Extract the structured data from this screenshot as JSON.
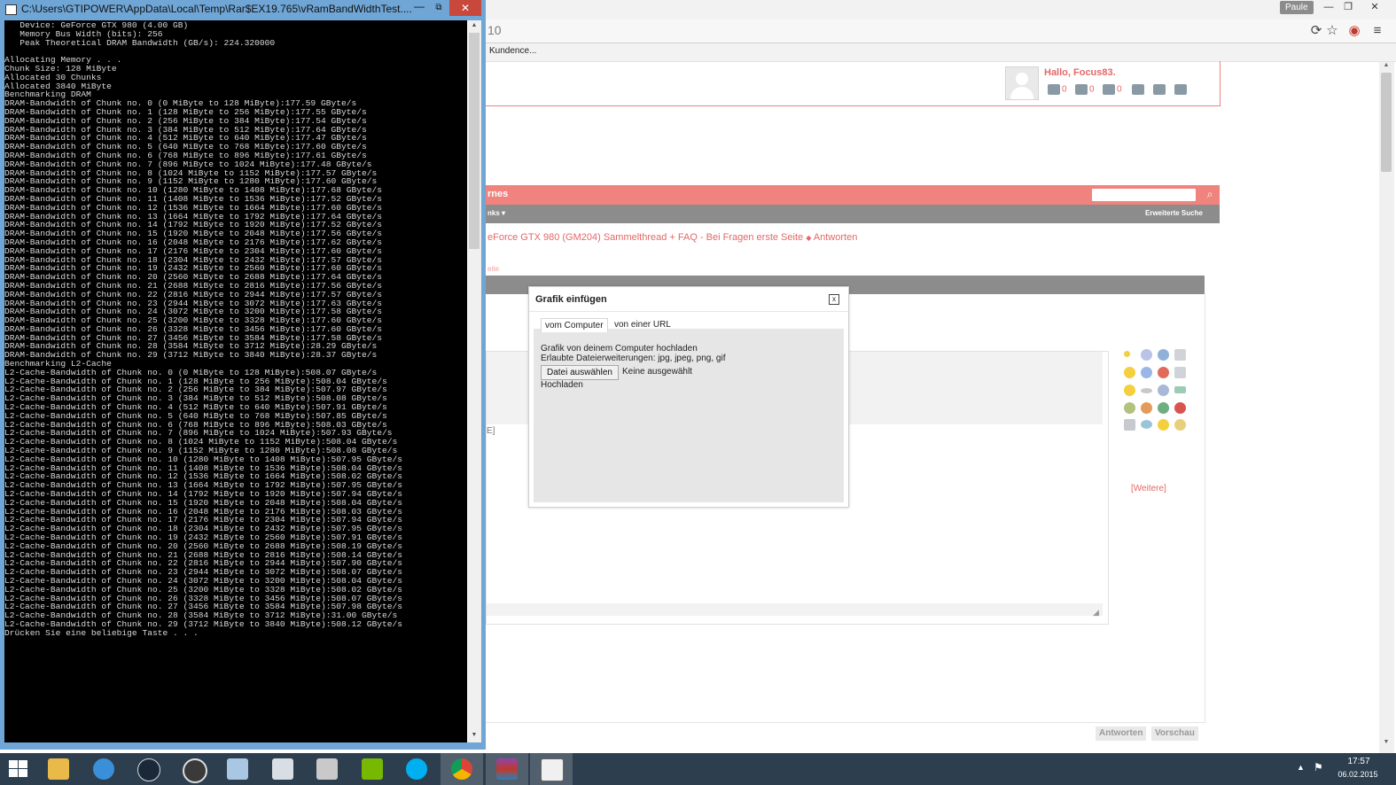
{
  "console": {
    "title": "C:\\Users\\GTIPOWER\\AppData\\Local\\Temp\\Rar$EX19.765\\vRamBandWidthTest....",
    "minimize_glyph": "—",
    "maximize_glyph": "⧉",
    "close_glyph": "✕",
    "lines": [
      "   Device: GeForce GTX 980 (4.00 GB)",
      "   Memory Bus Width (bits): 256",
      "   Peak Theoretical DRAM Bandwidth (GB/s): 224.320000",
      "",
      "Allocating Memory . . .",
      "Chunk Size: 128 MiByte",
      "Allocated 30 Chunks",
      "Allocated 3840 MiByte",
      "Benchmarking DRAM",
      "DRAM-Bandwidth of Chunk no. 0 (0 MiByte to 128 MiByte):177.59 GByte/s",
      "DRAM-Bandwidth of Chunk no. 1 (128 MiByte to 256 MiByte):177.55 GByte/s",
      "DRAM-Bandwidth of Chunk no. 2 (256 MiByte to 384 MiByte):177.54 GByte/s",
      "DRAM-Bandwidth of Chunk no. 3 (384 MiByte to 512 MiByte):177.64 GByte/s",
      "DRAM-Bandwidth of Chunk no. 4 (512 MiByte to 640 MiByte):177.47 GByte/s",
      "DRAM-Bandwidth of Chunk no. 5 (640 MiByte to 768 MiByte):177.60 GByte/s",
      "DRAM-Bandwidth of Chunk no. 6 (768 MiByte to 896 MiByte):177.61 GByte/s",
      "DRAM-Bandwidth of Chunk no. 7 (896 MiByte to 1024 MiByte):177.48 GByte/s",
      "DRAM-Bandwidth of Chunk no. 8 (1024 MiByte to 1152 MiByte):177.57 GByte/s",
      "DRAM-Bandwidth of Chunk no. 9 (1152 MiByte to 1280 MiByte):177.60 GByte/s",
      "DRAM-Bandwidth of Chunk no. 10 (1280 MiByte to 1408 MiByte):177.68 GByte/s",
      "DRAM-Bandwidth of Chunk no. 11 (1408 MiByte to 1536 MiByte):177.52 GByte/s",
      "DRAM-Bandwidth of Chunk no. 12 (1536 MiByte to 1664 MiByte):177.60 GByte/s",
      "DRAM-Bandwidth of Chunk no. 13 (1664 MiByte to 1792 MiByte):177.64 GByte/s",
      "DRAM-Bandwidth of Chunk no. 14 (1792 MiByte to 1920 MiByte):177.52 GByte/s",
      "DRAM-Bandwidth of Chunk no. 15 (1920 MiByte to 2048 MiByte):177.56 GByte/s",
      "DRAM-Bandwidth of Chunk no. 16 (2048 MiByte to 2176 MiByte):177.62 GByte/s",
      "DRAM-Bandwidth of Chunk no. 17 (2176 MiByte to 2304 MiByte):177.60 GByte/s",
      "DRAM-Bandwidth of Chunk no. 18 (2304 MiByte to 2432 MiByte):177.57 GByte/s",
      "DRAM-Bandwidth of Chunk no. 19 (2432 MiByte to 2560 MiByte):177.60 GByte/s",
      "DRAM-Bandwidth of Chunk no. 20 (2560 MiByte to 2688 MiByte):177.64 GByte/s",
      "DRAM-Bandwidth of Chunk no. 21 (2688 MiByte to 2816 MiByte):177.56 GByte/s",
      "DRAM-Bandwidth of Chunk no. 22 (2816 MiByte to 2944 MiByte):177.57 GByte/s",
      "DRAM-Bandwidth of Chunk no. 23 (2944 MiByte to 3072 MiByte):177.63 GByte/s",
      "DRAM-Bandwidth of Chunk no. 24 (3072 MiByte to 3200 MiByte):177.58 GByte/s",
      "DRAM-Bandwidth of Chunk no. 25 (3200 MiByte to 3328 MiByte):177.60 GByte/s",
      "DRAM-Bandwidth of Chunk no. 26 (3328 MiByte to 3456 MiByte):177.60 GByte/s",
      "DRAM-Bandwidth of Chunk no. 27 (3456 MiByte to 3584 MiByte):177.58 GByte/s",
      "DRAM-Bandwidth of Chunk no. 28 (3584 MiByte to 3712 MiByte):28.29 GByte/s",
      "DRAM-Bandwidth of Chunk no. 29 (3712 MiByte to 3840 MiByte):28.37 GByte/s",
      "Benchmarking L2-Cache",
      "L2-Cache-Bandwidth of Chunk no. 0 (0 MiByte to 128 MiByte):508.07 GByte/s",
      "L2-Cache-Bandwidth of Chunk no. 1 (128 MiByte to 256 MiByte):508.04 GByte/s",
      "L2-Cache-Bandwidth of Chunk no. 2 (256 MiByte to 384 MiByte):507.97 GByte/s",
      "L2-Cache-Bandwidth of Chunk no. 3 (384 MiByte to 512 MiByte):508.08 GByte/s",
      "L2-Cache-Bandwidth of Chunk no. 4 (512 MiByte to 640 MiByte):507.91 GByte/s",
      "L2-Cache-Bandwidth of Chunk no. 5 (640 MiByte to 768 MiByte):507.85 GByte/s",
      "L2-Cache-Bandwidth of Chunk no. 6 (768 MiByte to 896 MiByte):508.03 GByte/s",
      "L2-Cache-Bandwidth of Chunk no. 7 (896 MiByte to 1024 MiByte):507.93 GByte/s",
      "L2-Cache-Bandwidth of Chunk no. 8 (1024 MiByte to 1152 MiByte):508.04 GByte/s",
      "L2-Cache-Bandwidth of Chunk no. 9 (1152 MiByte to 1280 MiByte):508.08 GByte/s",
      "L2-Cache-Bandwidth of Chunk no. 10 (1280 MiByte to 1408 MiByte):507.95 GByte/s",
      "L2-Cache-Bandwidth of Chunk no. 11 (1408 MiByte to 1536 MiByte):508.04 GByte/s",
      "L2-Cache-Bandwidth of Chunk no. 12 (1536 MiByte to 1664 MiByte):508.02 GByte/s",
      "L2-Cache-Bandwidth of Chunk no. 13 (1664 MiByte to 1792 MiByte):507.95 GByte/s",
      "L2-Cache-Bandwidth of Chunk no. 14 (1792 MiByte to 1920 MiByte):507.94 GByte/s",
      "L2-Cache-Bandwidth of Chunk no. 15 (1920 MiByte to 2048 MiByte):508.04 GByte/s",
      "L2-Cache-Bandwidth of Chunk no. 16 (2048 MiByte to 2176 MiByte):508.03 GByte/s",
      "L2-Cache-Bandwidth of Chunk no. 17 (2176 MiByte to 2304 MiByte):507.94 GByte/s",
      "L2-Cache-Bandwidth of Chunk no. 18 (2304 MiByte to 2432 MiByte):507.95 GByte/s",
      "L2-Cache-Bandwidth of Chunk no. 19 (2432 MiByte to 2560 MiByte):507.91 GByte/s",
      "L2-Cache-Bandwidth of Chunk no. 20 (2560 MiByte to 2688 MiByte):508.19 GByte/s",
      "L2-Cache-Bandwidth of Chunk no. 21 (2688 MiByte to 2816 MiByte):508.14 GByte/s",
      "L2-Cache-Bandwidth of Chunk no. 22 (2816 MiByte to 2944 MiByte):507.90 GByte/s",
      "L2-Cache-Bandwidth of Chunk no. 23 (2944 MiByte to 3072 MiByte):508.07 GByte/s",
      "L2-Cache-Bandwidth of Chunk no. 24 (3072 MiByte to 3200 MiByte):508.04 GByte/s",
      "L2-Cache-Bandwidth of Chunk no. 25 (3200 MiByte to 3328 MiByte):508.02 GByte/s",
      "L2-Cache-Bandwidth of Chunk no. 26 (3328 MiByte to 3456 MiByte):508.07 GByte/s",
      "L2-Cache-Bandwidth of Chunk no. 27 (3456 MiByte to 3584 MiByte):507.98 GByte/s",
      "L2-Cache-Bandwidth of Chunk no. 28 (3584 MiByte to 3712 MiByte):31.00 GByte/s",
      "L2-Cache-Bandwidth of Chunk no. 29 (3712 MiByte to 3840 MiByte):508.12 GByte/s",
      "Drücken Sie eine beliebige Taste . . ."
    ]
  },
  "browser": {
    "user_badge": "Paule",
    "address_text": "10",
    "bookmark_item": "Kundence...",
    "icons": [
      "reload-icon",
      "star-icon",
      "extension-icon",
      "menu-icon"
    ]
  },
  "forum": {
    "greeting": "Hallo, Focus83.",
    "user_counters": [
      "0",
      "0",
      "0"
    ],
    "nav_title": "rnes",
    "subnav_links": "nks ▾",
    "advanced_search": "Erweiterte Suche",
    "breadcrumb": "eForce GTX 980 (GM204) Sammelthread + FAQ - Bei Fragen erste Seite",
    "breadcrumb_sep": "◆",
    "breadcrumb_last": "Antworten",
    "crumb_small": "eite",
    "editor_fragment": "E]",
    "more_link": "[Weitere]",
    "reply_button": "Antworten",
    "preview_button": "Vorschau"
  },
  "dialog": {
    "title": "Grafik einfügen",
    "close_glyph": "x",
    "tabs": [
      "vom Computer",
      "von einer URL"
    ],
    "upload_label": "Grafik von deinem Computer hochladen",
    "allowed_ext": "Erlaubte Dateierweiterungen: jpg, jpeg, png, gif",
    "choose_file": "Datei auswählen",
    "no_file": "Keine ausgewählt",
    "upload_button": "Hochladen"
  },
  "taskbar": {
    "apps": [
      "file-explorer-icon",
      "internet-explorer-icon",
      "steam-icon",
      "g-app-icon",
      "network-icon",
      "calculator-icon",
      "notepad-icon",
      "nvidia-icon",
      "skype-icon",
      "chrome-icon",
      "winrar-icon",
      "console-icon"
    ],
    "time": "17:57",
    "date": "06.02.2015"
  },
  "colors": {
    "accent_red": "#e46767",
    "nav_red": "#f0837d",
    "taskbar": "#2d3e4f",
    "console_frame": "#6fa6d6"
  }
}
